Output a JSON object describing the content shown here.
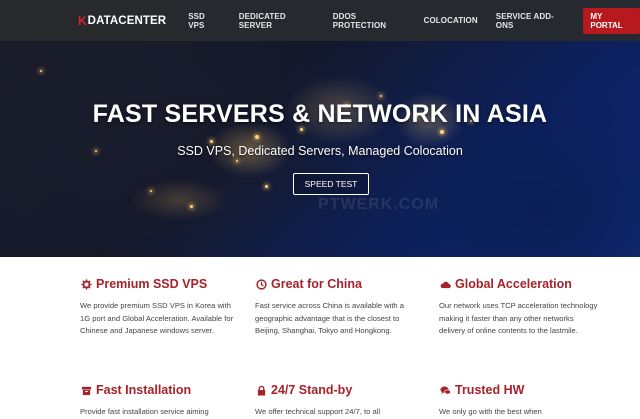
{
  "nav": {
    "logo_mark": "K",
    "logo_text": "DATACENTER",
    "items": [
      "SSD VPS",
      "DEDICATED SERVER",
      "DDOS PROTECTION",
      "COLOCATION",
      "SERVICE ADD-ONS"
    ],
    "portal_label": "MY PORTAL"
  },
  "hero": {
    "title": "FAST SERVERS & NETWORK IN ASIA",
    "subtitle": "SSD VPS, Dedicated Servers, Managed Colocation",
    "button_label": "SPEED TEST",
    "watermark": "PTWERK.COM"
  },
  "features": [
    {
      "icon": "gear-icon",
      "title": "Premium SSD VPS",
      "desc": "We provide premium SSD VPS in Korea with 1G port and Global Acceleration. Available for Chinese and Japanese windows server."
    },
    {
      "icon": "clock-icon",
      "title": "Great for China",
      "desc": "Fast service across China is available with a geographic advantage that is the closest to Beijing, Shanghai, Tokyo and Hongkong."
    },
    {
      "icon": "cloud-icon",
      "title": "Global Acceleration",
      "desc": "Our network uses TCP acceleration technology making it faster than any other networks delivery of online contents to the lastmile."
    },
    {
      "icon": "box-icon",
      "title": "Fast Installation",
      "desc": "Provide fast installation service aiming"
    },
    {
      "icon": "lock-icon",
      "title": "24/7 Stand-by",
      "desc": "We offer technical support 24/7, to all"
    },
    {
      "icon": "chat-icon",
      "title": "Trusted HW",
      "desc": "We only go with the best when"
    }
  ],
  "colors": {
    "accent": "#a7222a",
    "portal": "#b8191f",
    "navbar": "#2a2c30"
  }
}
